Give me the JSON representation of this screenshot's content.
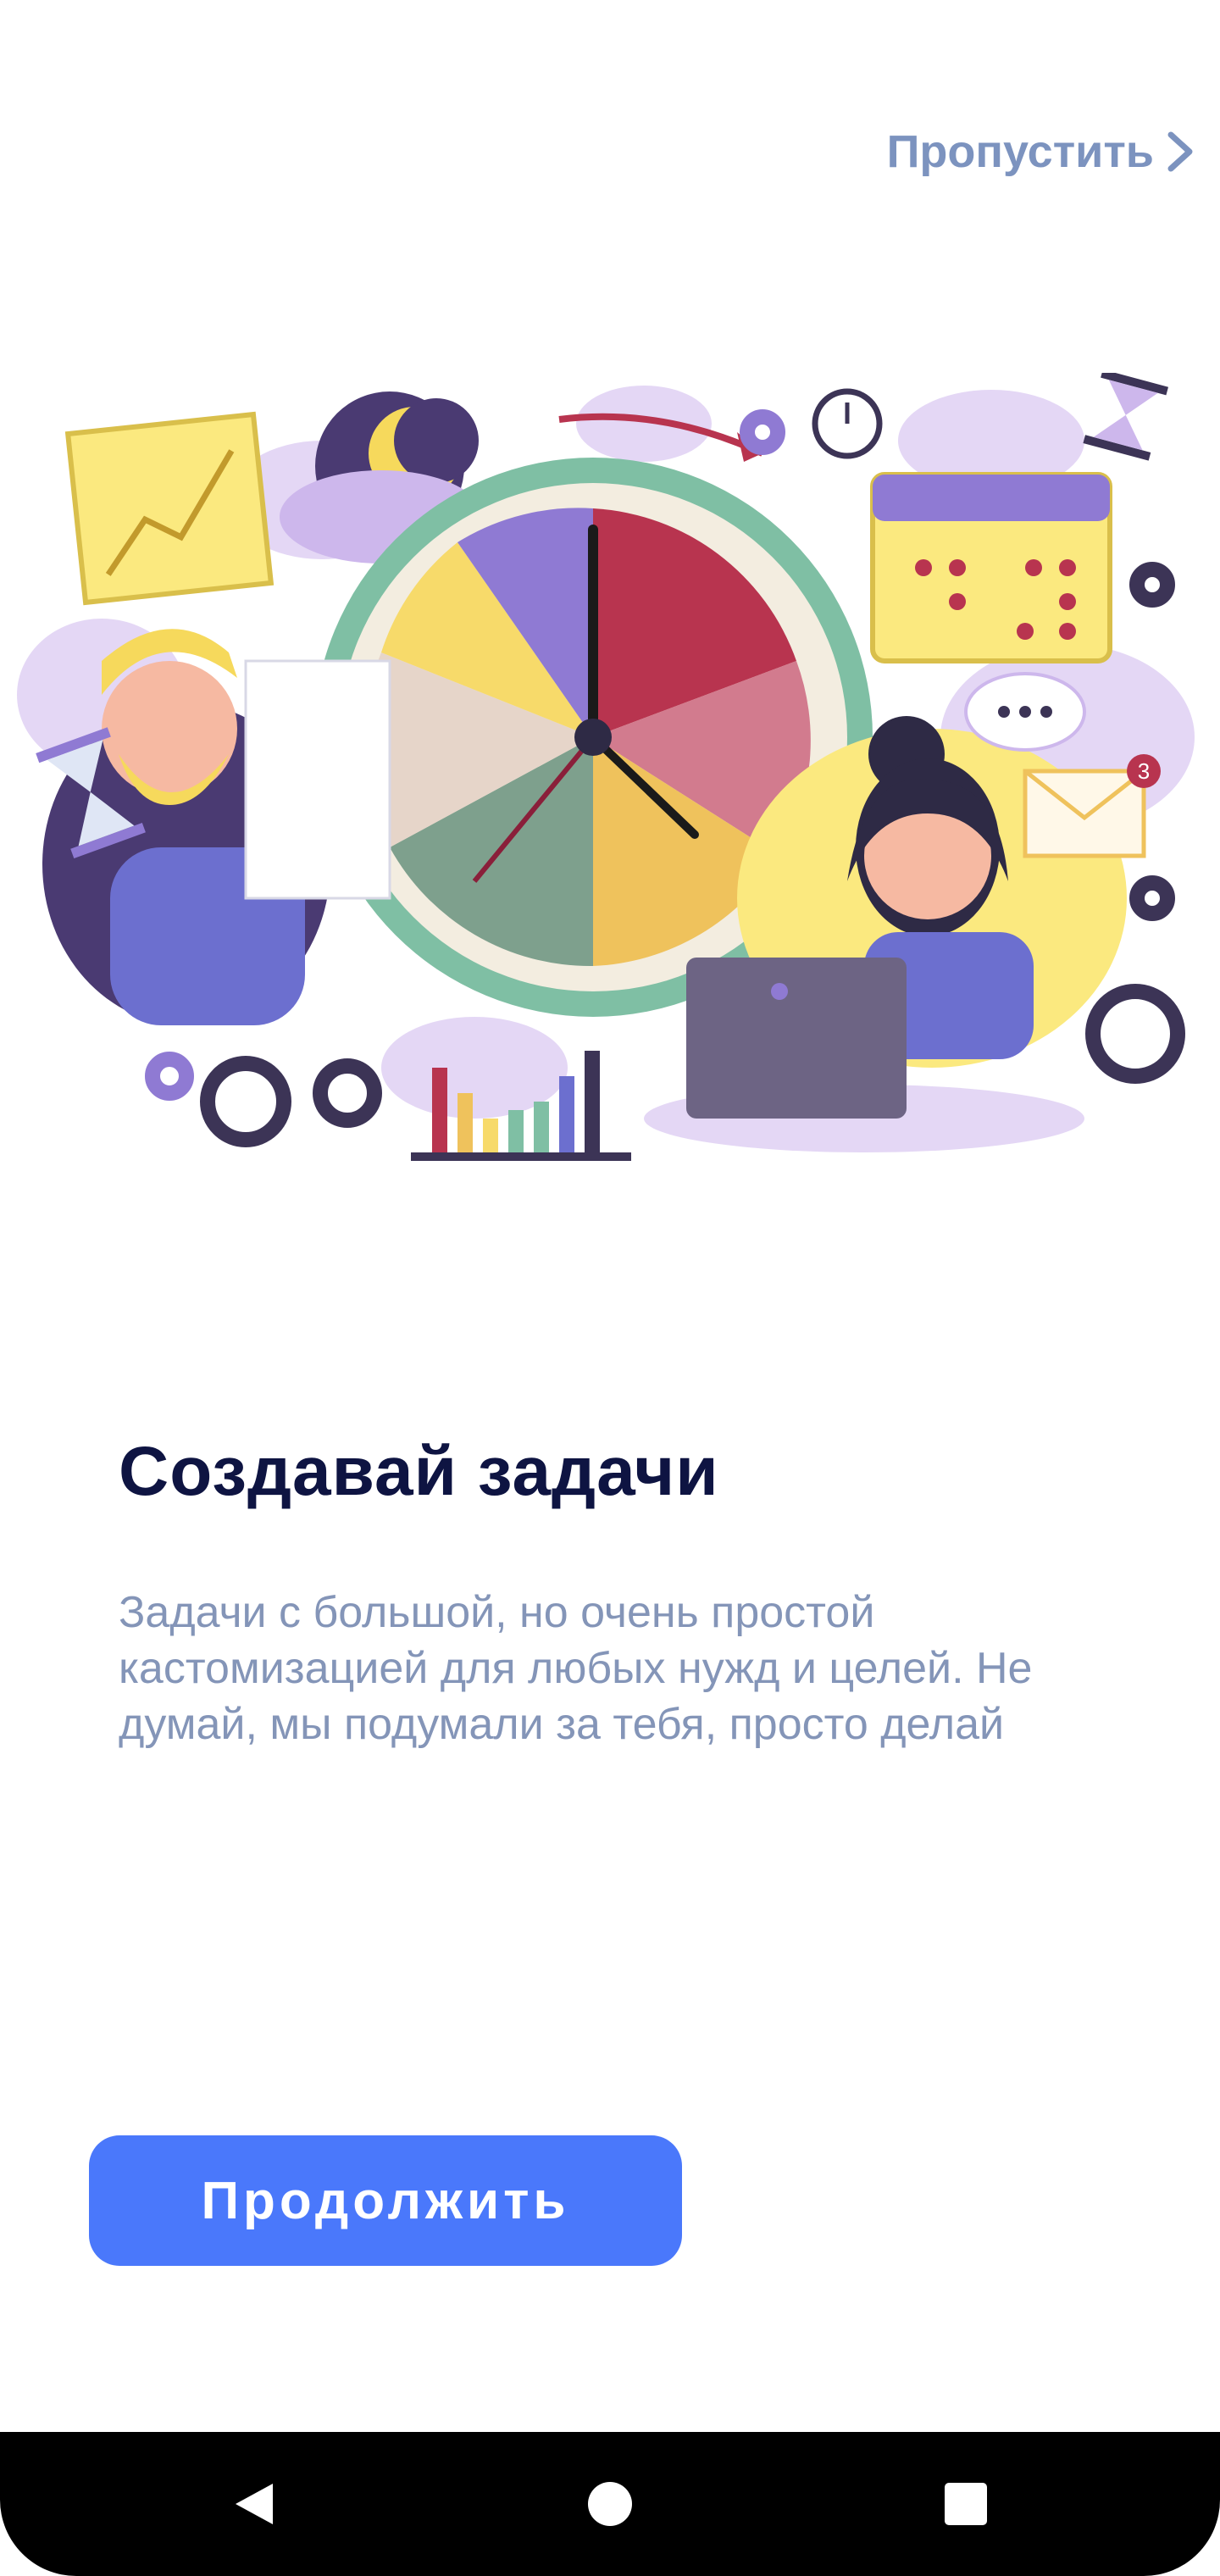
{
  "skip": {
    "label": "Пропустить",
    "icon": "chevron-right-icon"
  },
  "illustration": {
    "subject": "time-management-illustration",
    "calendar_badge": "3"
  },
  "onboarding": {
    "title": "Создавай задачи",
    "description": "Задачи с большой, но очень простой кастомизацией для любых нужд и целей. Не думай, мы подумали за тебя, просто делай"
  },
  "cta": {
    "label": "Продолжить",
    "color": "#4a78fb"
  },
  "navbar": {
    "back_icon": "back-triangle-icon",
    "home_icon": "home-circle-icon",
    "recents_icon": "recents-square-icon"
  }
}
